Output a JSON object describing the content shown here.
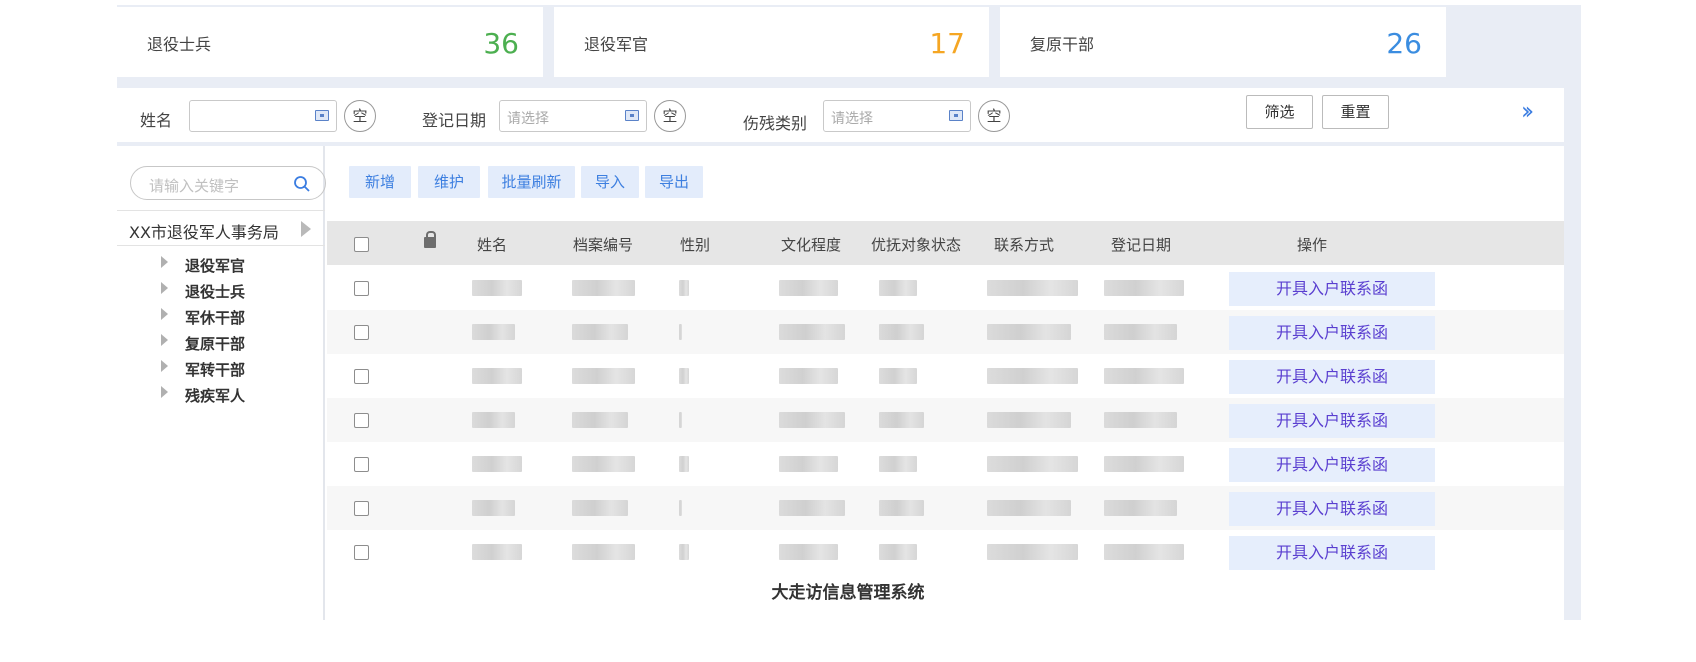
{
  "stats": [
    {
      "label": "退役士兵",
      "value": "36",
      "color": "#4caf50"
    },
    {
      "label": "退役军官",
      "value": "17",
      "color": "#f5a623"
    },
    {
      "label": "复原干部",
      "value": "26",
      "color": "#3b8de0"
    }
  ],
  "filters": {
    "name_label": "姓名",
    "name_value": "",
    "date_label": "登记日期",
    "date_placeholder": "请选择",
    "disability_label": "伤残类别",
    "disability_placeholder": "请选择",
    "clear_label": "空",
    "filter_button": "筛选",
    "reset_button": "重置"
  },
  "sidebar": {
    "search_placeholder": "请输入关键字",
    "org_name": "XX市退役军人事务局",
    "tree": [
      "退役军官",
      "退役士兵",
      "军休干部",
      "复原干部",
      "军转干部",
      "残疾军人"
    ]
  },
  "actions": [
    "新增",
    "维护",
    "批量刷新",
    "导入",
    "导出"
  ],
  "table": {
    "columns": [
      "姓名",
      "档案编号",
      "性别",
      "文化程度",
      "优抚对象状态",
      "联系方式",
      "登记日期",
      "操作"
    ],
    "row_action": "开具入户联系函",
    "row_count": 7
  },
  "caption": "大走访信息管理系统"
}
